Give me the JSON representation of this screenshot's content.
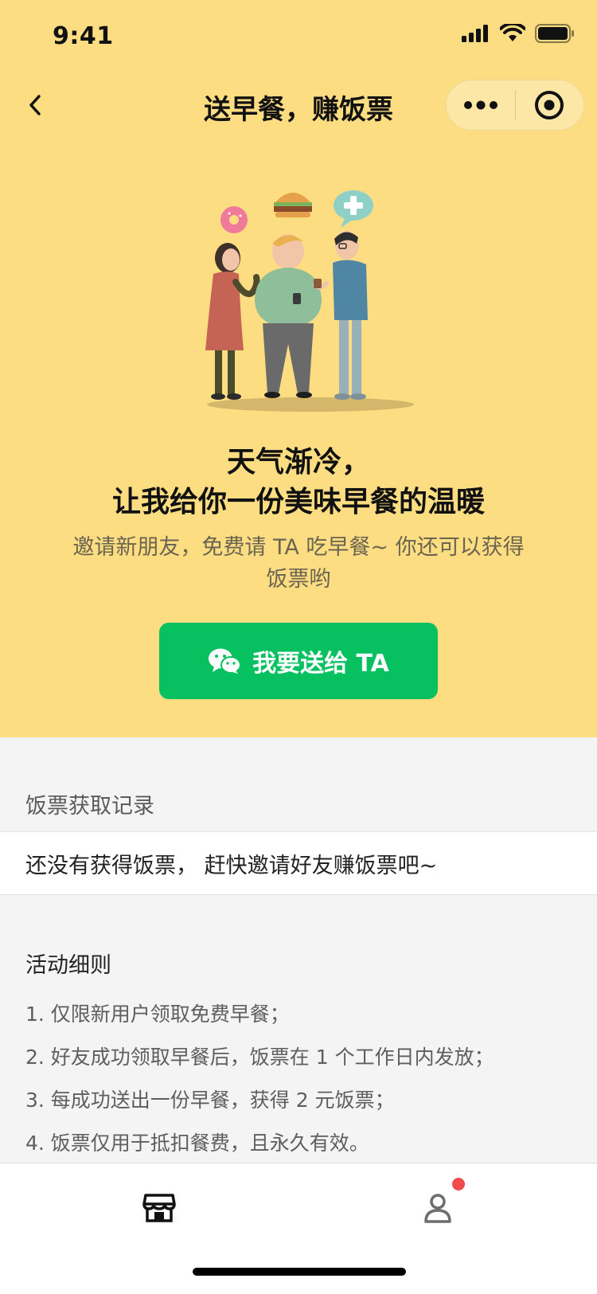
{
  "status_bar": {
    "time": "9:41"
  },
  "nav": {
    "title": "送早餐，赚饭票"
  },
  "hero": {
    "headline_line1": "天气渐冷，",
    "headline_line2": "让我给你一份美味早餐的温暖",
    "subtext": "邀请新朋友，免费请 TA 吃早餐~ 你还可以获得饭票哟",
    "cta_label": "我要送给 TA"
  },
  "records": {
    "label": "饭票获取记录",
    "empty_text": "还没有获得饭票， 赶快邀请好友赚饭票吧~"
  },
  "rules": {
    "title": "活动细则",
    "items": [
      "1. 仅限新用户领取免费早餐；",
      "2. 好友成功领取早餐后，饭票在 1 个工作日内发放；",
      "3. 每成功送出一份早餐，获得 2 元饭票；",
      "4. 饭票仅用于抵扣餐费，且永久有效。"
    ]
  },
  "tabbar": {
    "tabs": [
      {
        "icon": "store-icon"
      },
      {
        "icon": "person-icon",
        "badge": true
      }
    ]
  },
  "colors": {
    "hero_bg": "#FDDD81",
    "cta_bg": "#07C160",
    "page_bg": "#f4f4f4",
    "badge": "#F24B4B"
  }
}
